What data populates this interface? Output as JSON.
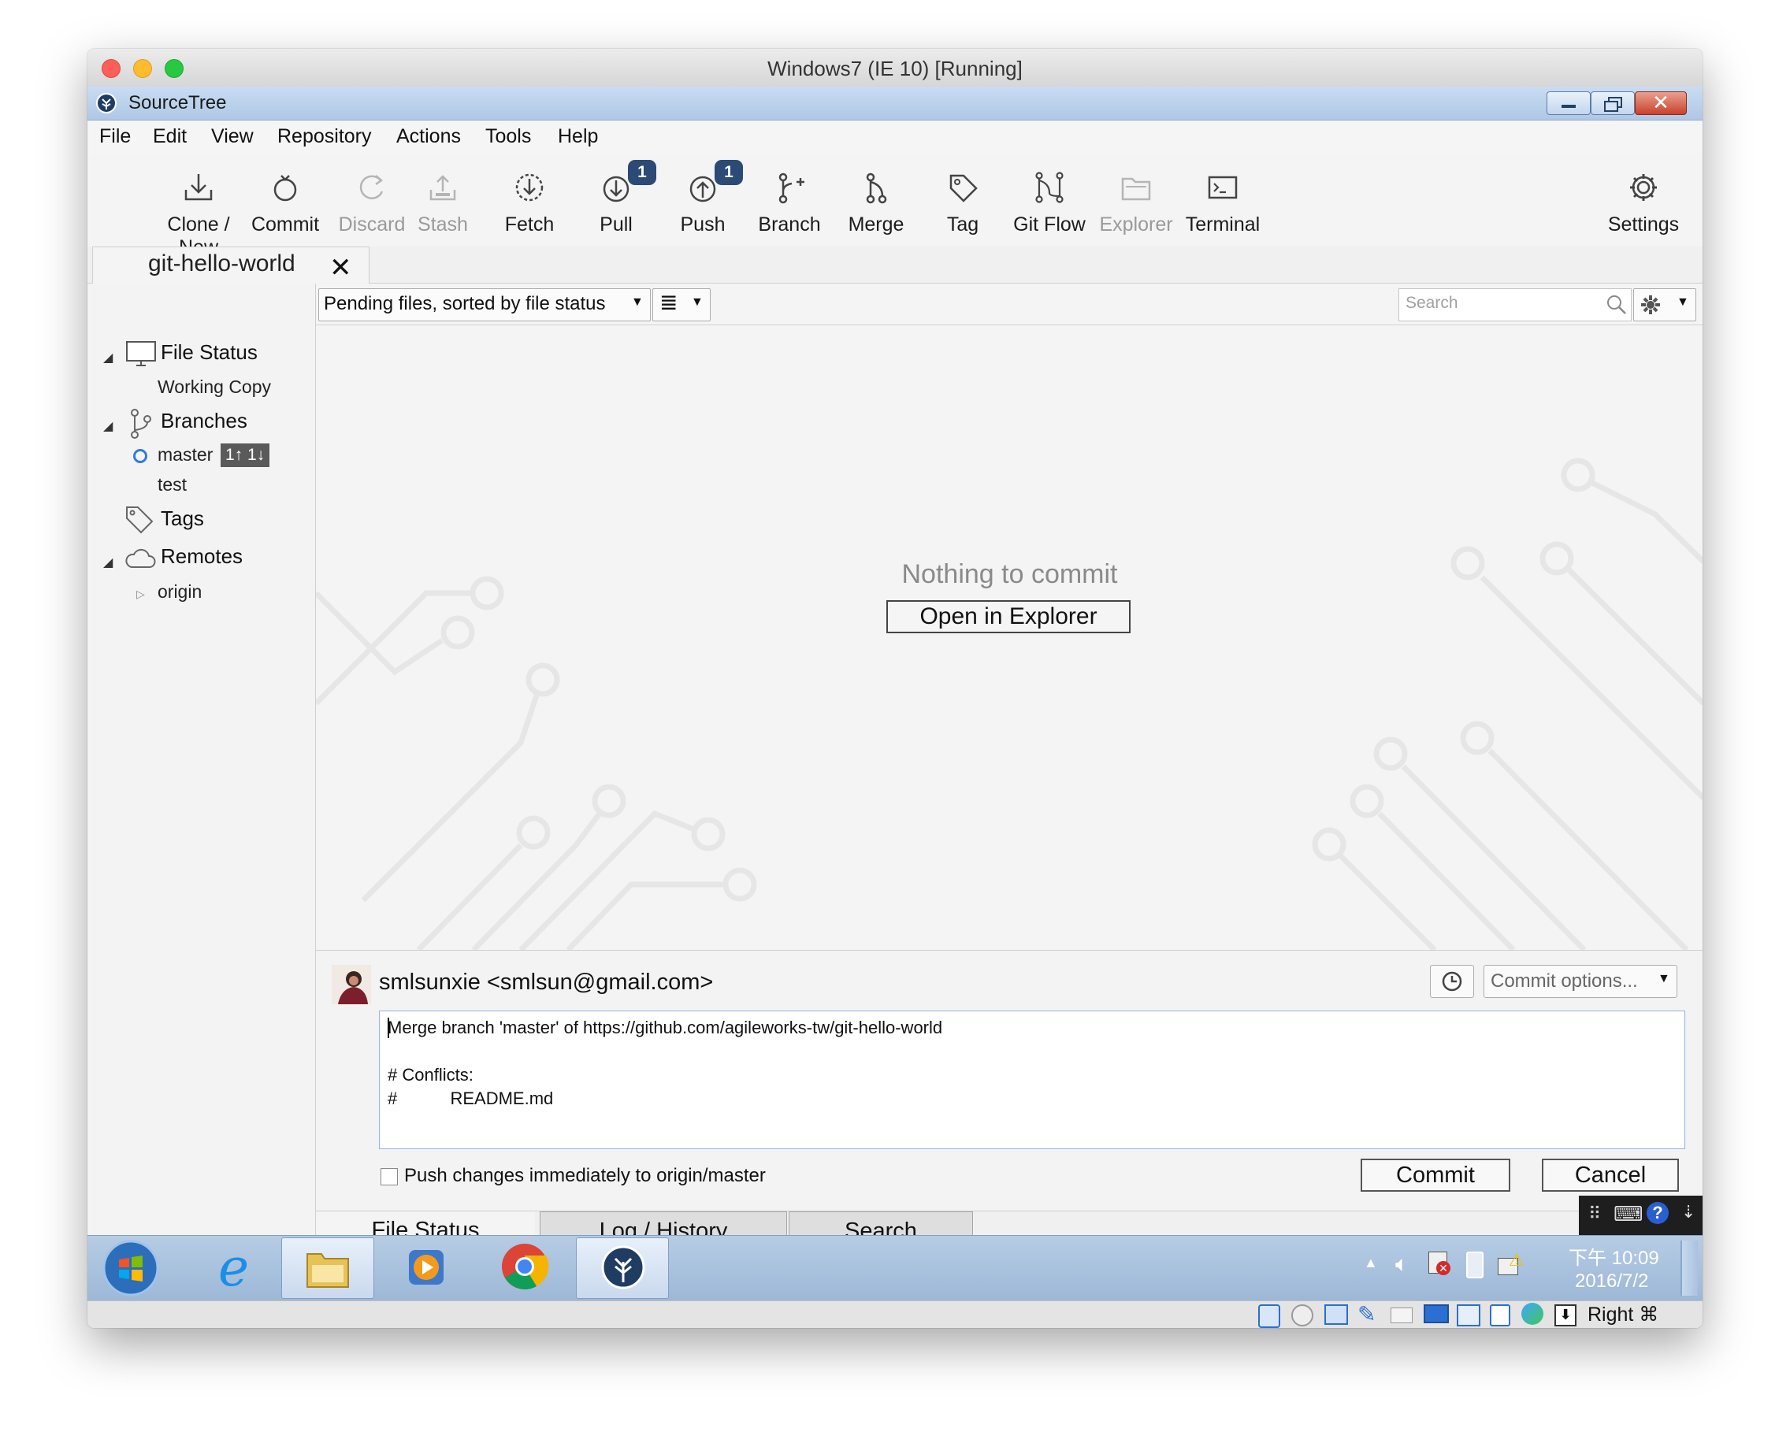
{
  "mac": {
    "title": "Windows7 (IE 10) [Running]"
  },
  "app": {
    "title": "SourceTree"
  },
  "menu": [
    "File",
    "Edit",
    "View",
    "Repository",
    "Actions",
    "Tools",
    "Help"
  ],
  "toolbar": {
    "items": [
      {
        "label": "Clone / New",
        "icon": "clone-icon",
        "enabled": true
      },
      {
        "label": "Commit",
        "icon": "commit-icon",
        "enabled": true
      },
      {
        "label": "Discard",
        "icon": "discard-icon",
        "enabled": false
      },
      {
        "label": "Stash",
        "icon": "stash-icon",
        "enabled": false
      },
      {
        "label": "Fetch",
        "icon": "fetch-icon",
        "enabled": true
      },
      {
        "label": "Pull",
        "icon": "pull-icon",
        "enabled": true,
        "badge": "1"
      },
      {
        "label": "Push",
        "icon": "push-icon",
        "enabled": true,
        "badge": "1"
      },
      {
        "label": "Branch",
        "icon": "branch-icon",
        "enabled": true
      },
      {
        "label": "Merge",
        "icon": "merge-icon",
        "enabled": true
      },
      {
        "label": "Tag",
        "icon": "tag-icon",
        "enabled": true
      },
      {
        "label": "Git Flow",
        "icon": "git-flow-icon",
        "enabled": true
      },
      {
        "label": "Explorer",
        "icon": "explorer-icon",
        "enabled": false
      },
      {
        "label": "Terminal",
        "icon": "terminal-icon",
        "enabled": true
      }
    ],
    "settings_label": "Settings"
  },
  "repo_tab": {
    "label": "git-hello-world"
  },
  "sidebar": {
    "file_status": "File Status",
    "working_copy": "Working Copy",
    "branches": "Branches",
    "branch_master": "master",
    "master_badge": "1↑ 1↓",
    "branch_test": "test",
    "tags": "Tags",
    "remotes": "Remotes",
    "remote_origin": "origin"
  },
  "filter": {
    "sort_label": "Pending files, sorted by file status",
    "search_placeholder": "Search"
  },
  "content": {
    "empty_text": "Nothing to commit",
    "open_explorer": "Open in Explorer"
  },
  "commit": {
    "author": "smlsunxie <smlsun@gmail.com>",
    "options_label": "Commit options...",
    "message_lines": [
      "Merge branch 'master' of https://github.com/agileworks-tw/git-hello-world",
      "",
      "# Conflicts:",
      "#           README.md"
    ],
    "push_label": "Push changes immediately to origin/master",
    "push_checked": false,
    "commit_button": "Commit",
    "cancel_button": "Cancel"
  },
  "bottom_tabs": [
    "File Status",
    "Log / History",
    "Search"
  ],
  "taskbar": {
    "apps": [
      "start-orb",
      "internet-explorer",
      "file-explorer",
      "media-player",
      "chrome",
      "sourcetree"
    ],
    "time": "下午 10:09",
    "date": "2016/7/2"
  },
  "vbox": {
    "host_key": "Right ⌘"
  },
  "colors": {
    "accent": "#2b4a75",
    "titlebar": "#b6cce4",
    "close": "#d9463b"
  }
}
